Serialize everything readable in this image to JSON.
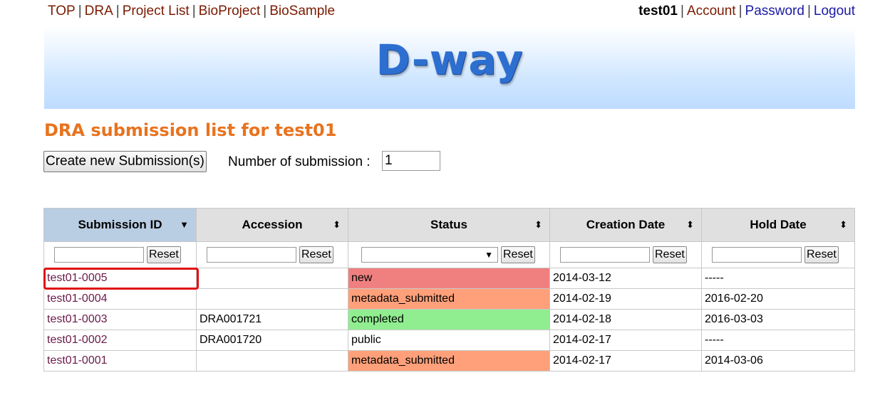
{
  "nav": {
    "items": [
      "TOP",
      "DRA",
      "Project List",
      "BioProject",
      "BioSample"
    ],
    "separator": "|"
  },
  "account": {
    "username": "test01",
    "account_label": "Account",
    "password_label": "Password",
    "logout_label": "Logout"
  },
  "banner": {
    "logo_text": "D-way"
  },
  "page": {
    "title": "DRA submission list for test01"
  },
  "submission_form": {
    "create_button_label": "Create new Submission(s)",
    "number_label": "Number of submission :",
    "number_value": "1"
  },
  "table": {
    "columns": [
      "Submission ID",
      "Accession",
      "Status",
      "Creation Date",
      "Hold Date"
    ],
    "sort_icons": [
      "▼",
      "⬍",
      "⬍",
      "⬍",
      "⬍"
    ],
    "reset_label": "Reset",
    "rows": [
      {
        "id": "test01-0005",
        "accession": "",
        "status": "new",
        "created": "2014-03-12",
        "hold": "-----"
      },
      {
        "id": "test01-0004",
        "accession": "",
        "status": "metadata_submitted",
        "created": "2014-02-19",
        "hold": "2016-02-20"
      },
      {
        "id": "test01-0003",
        "accession": "DRA001721",
        "status": "completed",
        "created": "2014-02-18",
        "hold": "2016-03-03"
      },
      {
        "id": "test01-0002",
        "accession": "DRA001720",
        "status": "public",
        "created": "2014-02-17",
        "hold": "-----"
      },
      {
        "id": "test01-0001",
        "accession": "",
        "status": "metadata_submitted",
        "created": "2014-02-17",
        "hold": "2014-03-06"
      }
    ]
  },
  "colors": {
    "status_new": "#f08080",
    "status_metadata_submitted": "#ffa07a",
    "status_completed": "#90ee90",
    "heading": "#e8731f",
    "highlight": "#e01010"
  }
}
